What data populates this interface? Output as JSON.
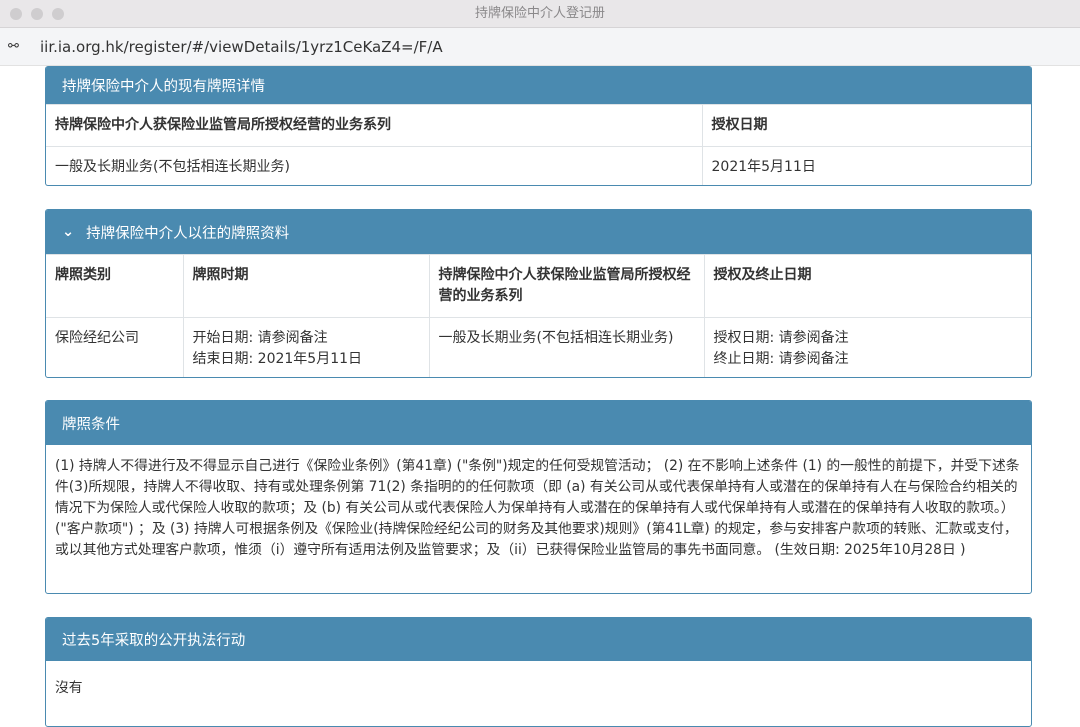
{
  "window": {
    "title": "持牌保险中介人登记册"
  },
  "address_bar": {
    "url": "iir.ia.org.hk/register/#/viewDetails/1yrz1CeKaZ4=/F/A"
  },
  "current_license": {
    "title": "持牌保险中介人的现有牌照详情",
    "headers": [
      "持牌保险中介人获保险业监管局所授权经营的业务系列",
      "授权日期"
    ],
    "row": [
      "一般及长期业务(不包括相连长期业务)",
      "2021年5月11日"
    ]
  },
  "past_license": {
    "title": "持牌保险中介人以往的牌照资料",
    "headers": [
      "牌照类别",
      "牌照时期",
      "持牌保险中介人获保险业监管局所授权经营的业务系列",
      "授权及终止日期"
    ],
    "row": {
      "category": "保险经纪公司",
      "start": "开始日期: 请参阅备注",
      "end": "结束日期: 2021年5月11日",
      "business": "一般及长期业务(不包括相连长期业务)",
      "auth": "授权日期: 请参阅备注",
      "term": "终止日期: 请参阅备注"
    }
  },
  "conditions": {
    "title": "牌照条件",
    "text": "(1) 持牌人不得进行及不得显示自己进行《保险业条例》(第41章) (\"条例\")规定的任何受规管活动； (2) 在不影响上述条件 (1) 的一般性的前提下，并受下述条件(3)所规限，持牌人不得收取、持有或处理条例第 71(2) 条指明的的任何款项（即 (a) 有关公司从或代表保单持有人或潜在的保单持有人在与保险合约相关的情况下为保险人或代保险人收取的款项；及 (b) 有关公司从或代表保险人为保单持有人或潜在的保单持有人或代保单持有人或潜在的保单持有人收取的款项。） (\"客户款项\") ；及 (3) 持牌人可根据条例及《保险业(持牌保险经纪公司的财务及其他要求)规则》(第41L章) 的规定，参与安排客户款项的转账、汇款或支付，或以其他方式处理客户款项，惟须（i）遵守所有适用法例及监管要求；及（ii）已获得保险业监管局的事先书面同意。 (生效日期: 2025年10月28日 )"
  },
  "enforcement": {
    "title": "过去5年采取的公开执法行动",
    "text": "沒有"
  }
}
